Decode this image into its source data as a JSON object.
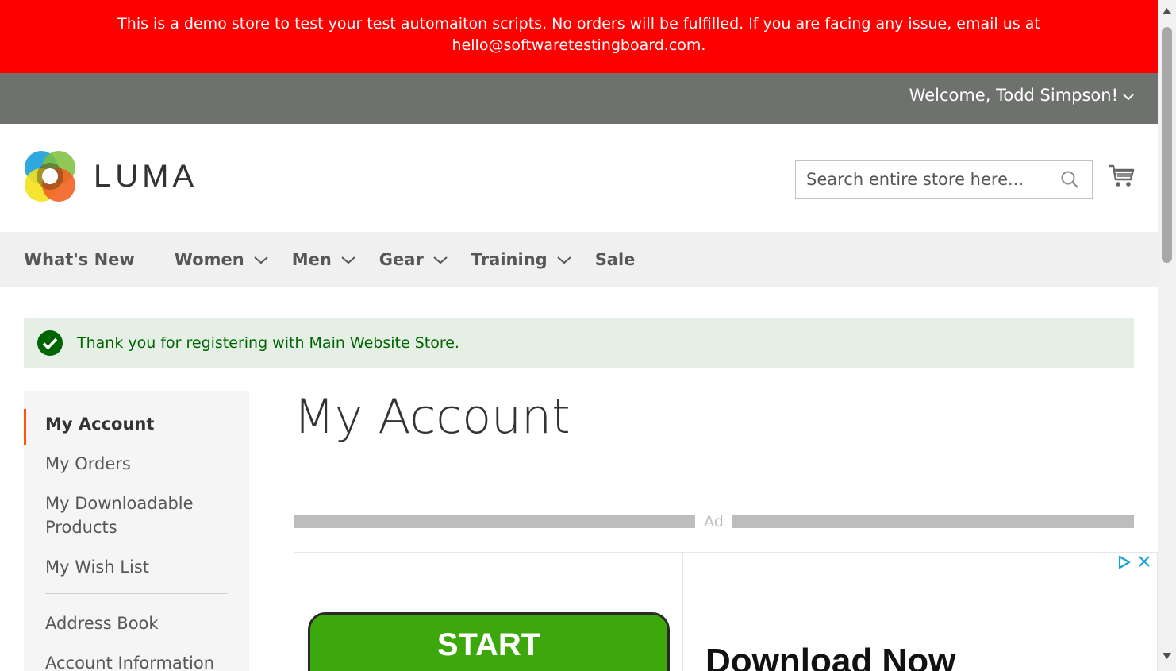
{
  "banner": {
    "text": "This is a demo store to test your test automaiton scripts. No orders will be fulfilled. If you are facing any issue, email us at hello@softwaretestingboard.com."
  },
  "topbar": {
    "welcome": "Welcome, Todd Simpson!"
  },
  "header": {
    "logo_text": "LUMA",
    "search_placeholder": "Search entire store here..."
  },
  "nav": {
    "items": [
      {
        "label": "What's New",
        "dropdown": false
      },
      {
        "label": "Women",
        "dropdown": true
      },
      {
        "label": "Men",
        "dropdown": true
      },
      {
        "label": "Gear",
        "dropdown": true
      },
      {
        "label": "Training",
        "dropdown": true
      },
      {
        "label": "Sale",
        "dropdown": false
      }
    ]
  },
  "message": {
    "success": "Thank you for registering with Main Website Store."
  },
  "sidebar": {
    "items": [
      {
        "label": "My Account",
        "active": true
      },
      {
        "label": "My Orders"
      },
      {
        "label": "My Downloadable Products"
      },
      {
        "label": "My Wish List"
      },
      {
        "label": "Address Book"
      },
      {
        "label": "Account Information"
      }
    ]
  },
  "main": {
    "title": "My Account"
  },
  "ad": {
    "label": "Ad",
    "button_text": "START",
    "headline": "Download Now"
  },
  "colors": {
    "banner_bg": "#ff0000",
    "topbar_bg": "#6e716e",
    "accent": "#ff5501",
    "success_bg": "#e5efe5",
    "success_text": "#006400"
  }
}
